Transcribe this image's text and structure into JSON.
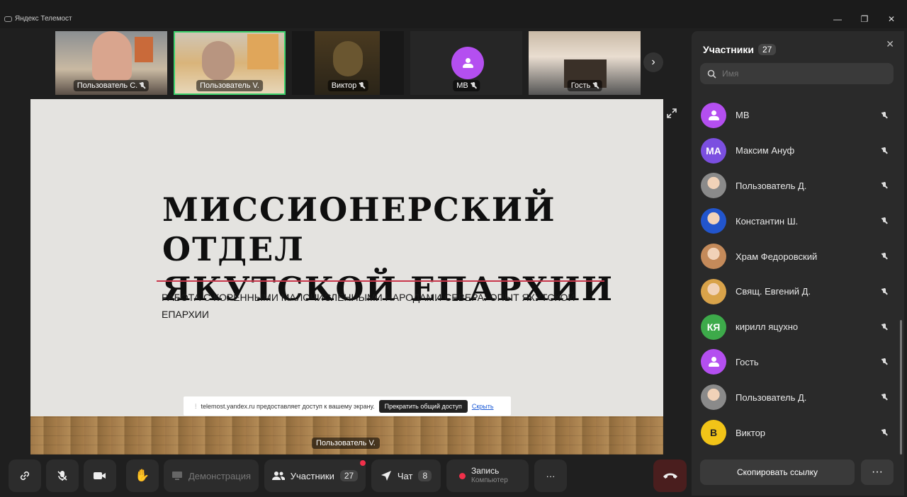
{
  "window": {
    "title": "Яндекс Телемост",
    "minimize_glyph": "—",
    "maximize_glyph": "❐",
    "close_glyph": "✕"
  },
  "thumbnails": [
    {
      "label": "Пользователь С.",
      "muted": true,
      "active": false
    },
    {
      "label": "Пользователь V.",
      "muted": false,
      "active": true
    },
    {
      "label": "Виктор",
      "muted": true,
      "active": false
    },
    {
      "label": "MB",
      "muted": true,
      "active": false
    },
    {
      "label": "Гость",
      "muted": true,
      "active": false
    }
  ],
  "next_glyph": "›",
  "slide": {
    "title_line1": "МИССИОНЕРСКИЙ ОТДЕЛ",
    "title_line2": "ЯКУТСКОЙ ЕПАРХИИ",
    "subtitle": "РАБОТА С КОРЕННЫМИ МАЛОЧИСЛЕННЫМИ НАРОДАМИ СЕВЕРА: ОПЫТ ЯКУТСКОЙ ЕПАРХИИ"
  },
  "share_bar": {
    "text": "telemost.yandex.ru предоставляет доступ к вашему экрану.",
    "stop_label": "Прекратить общий доступ",
    "hide_label": "Скрыть"
  },
  "presenter_label": "Пользователь V.",
  "toolbar": {
    "demo_label": "Демонстрация",
    "participants_label": "Участники",
    "participants_count": "27",
    "chat_label": "Чат",
    "chat_count": "8",
    "record_label": "Запись",
    "record_sub": "Компьютер",
    "more_glyph": "···"
  },
  "panel": {
    "title": "Участники",
    "count": "27",
    "search_placeholder": "Имя",
    "copy_link_label": "Скопировать ссылку",
    "more_glyph": "···",
    "participants": [
      {
        "name": "MB",
        "initials": "",
        "color": "#b44ff0",
        "kind": "glyph"
      },
      {
        "name": "Максим Ануф",
        "initials": "МА",
        "color": "#7b4fe0",
        "kind": "initials"
      },
      {
        "name": "Пользователь Д.",
        "initials": "",
        "color": "#8a8a8a",
        "kind": "photo"
      },
      {
        "name": "Константин Ш.",
        "initials": "",
        "color": "#2255cc",
        "kind": "photo"
      },
      {
        "name": "Храм Федоровский",
        "initials": "",
        "color": "#c48a5a",
        "kind": "photo"
      },
      {
        "name": "Свящ. Евгений Д.",
        "initials": "",
        "color": "#d9a34a",
        "kind": "photo"
      },
      {
        "name": "кирилл яцухно",
        "initials": "КЯ",
        "color": "#3daa4a",
        "kind": "initials"
      },
      {
        "name": "Гость",
        "initials": "",
        "color": "#b44ff0",
        "kind": "glyph"
      },
      {
        "name": "Пользователь Д.",
        "initials": "",
        "color": "#8a8a8a",
        "kind": "photo"
      },
      {
        "name": "Виктор",
        "initials": "В",
        "color": "#f2c418",
        "kind": "initials"
      }
    ]
  }
}
